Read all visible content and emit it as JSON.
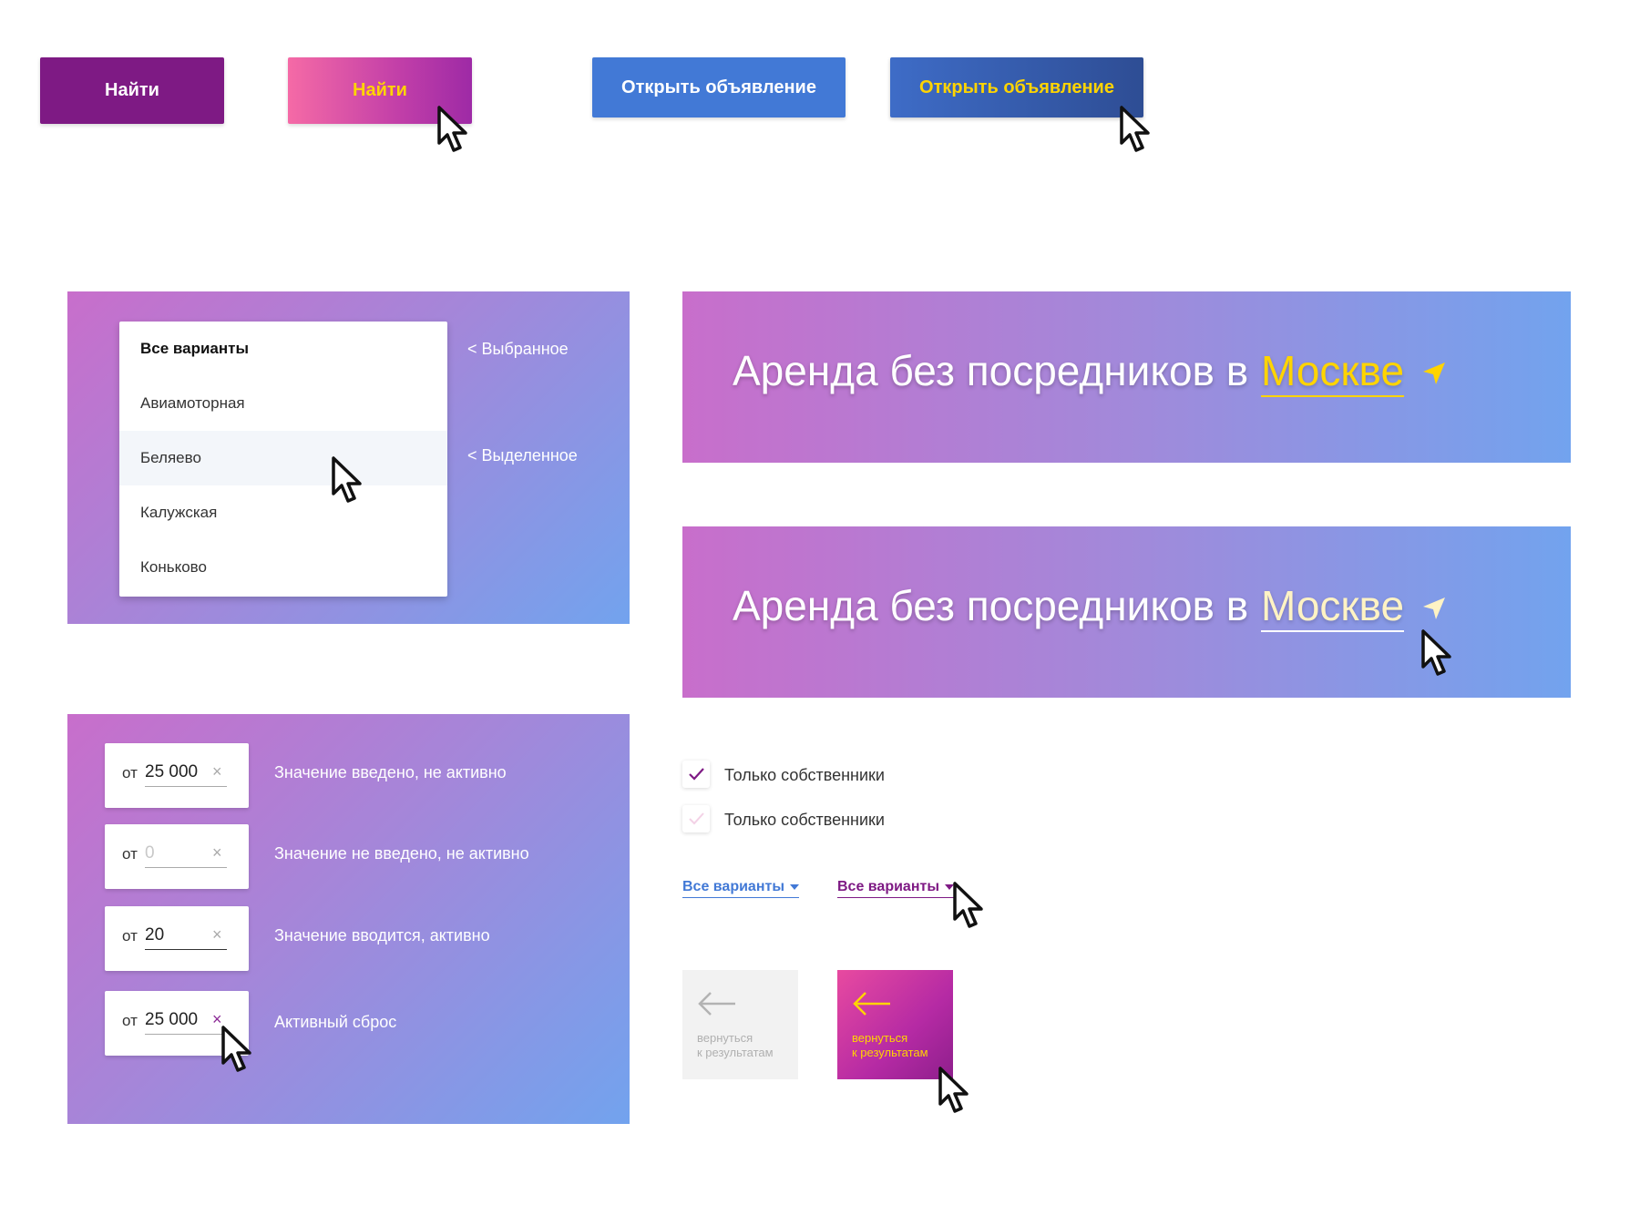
{
  "buttons": {
    "find_label": "Найти",
    "find_hover_label": "Найти",
    "open_label": "Открыть объявление",
    "open_hover_label": "Открыть объявление"
  },
  "dropdown": {
    "items": [
      {
        "label": "Все варианты",
        "state": "header"
      },
      {
        "label": "Авиамоторная",
        "state": "normal"
      },
      {
        "label": "Беляево",
        "state": "hover"
      },
      {
        "label": "Калужская",
        "state": "normal"
      },
      {
        "label": "Коньково",
        "state": "normal"
      }
    ],
    "note_selected": "< Выбранное",
    "note_highlighted": "< Выделенное"
  },
  "banners": [
    {
      "title": "Аренда без посредников в",
      "city": "Москве",
      "state": "normal"
    },
    {
      "title": "Аренда без посредников в",
      "city": "Москве",
      "state": "hover"
    }
  ],
  "inputs": [
    {
      "prefix": "от",
      "value": "25 000",
      "placeholder": "",
      "label": "Значение введено, не активно"
    },
    {
      "prefix": "от",
      "value": "",
      "placeholder": "0",
      "label": "Значение не введено, не активно"
    },
    {
      "prefix": "от",
      "value": "20",
      "placeholder": "",
      "label": "Значение вводится, активно"
    },
    {
      "prefix": "от",
      "value": "25 000",
      "placeholder": "",
      "label": "Активный сброс"
    }
  ],
  "clear_symbol": "×",
  "checkboxes": [
    {
      "label": "Только собственники",
      "checked": true
    },
    {
      "label": "Только собственники",
      "checked": false
    }
  ],
  "select_links": [
    {
      "label": "Все варианты",
      "color": "#4279d6"
    },
    {
      "label": "Все варианты",
      "color": "#7e1a84"
    }
  ],
  "back_tiles": [
    {
      "line1": "вернуться",
      "line2": "к результатам",
      "state": "normal"
    },
    {
      "line1": "вернуться",
      "line2": "к результатам",
      "state": "hover"
    }
  ],
  "colors": {
    "purple": "#7e1a84",
    "blue": "#4279d6",
    "yellow": "#ffd400",
    "gradient_start": "#c86ecb",
    "gradient_end": "#72a3ee"
  }
}
